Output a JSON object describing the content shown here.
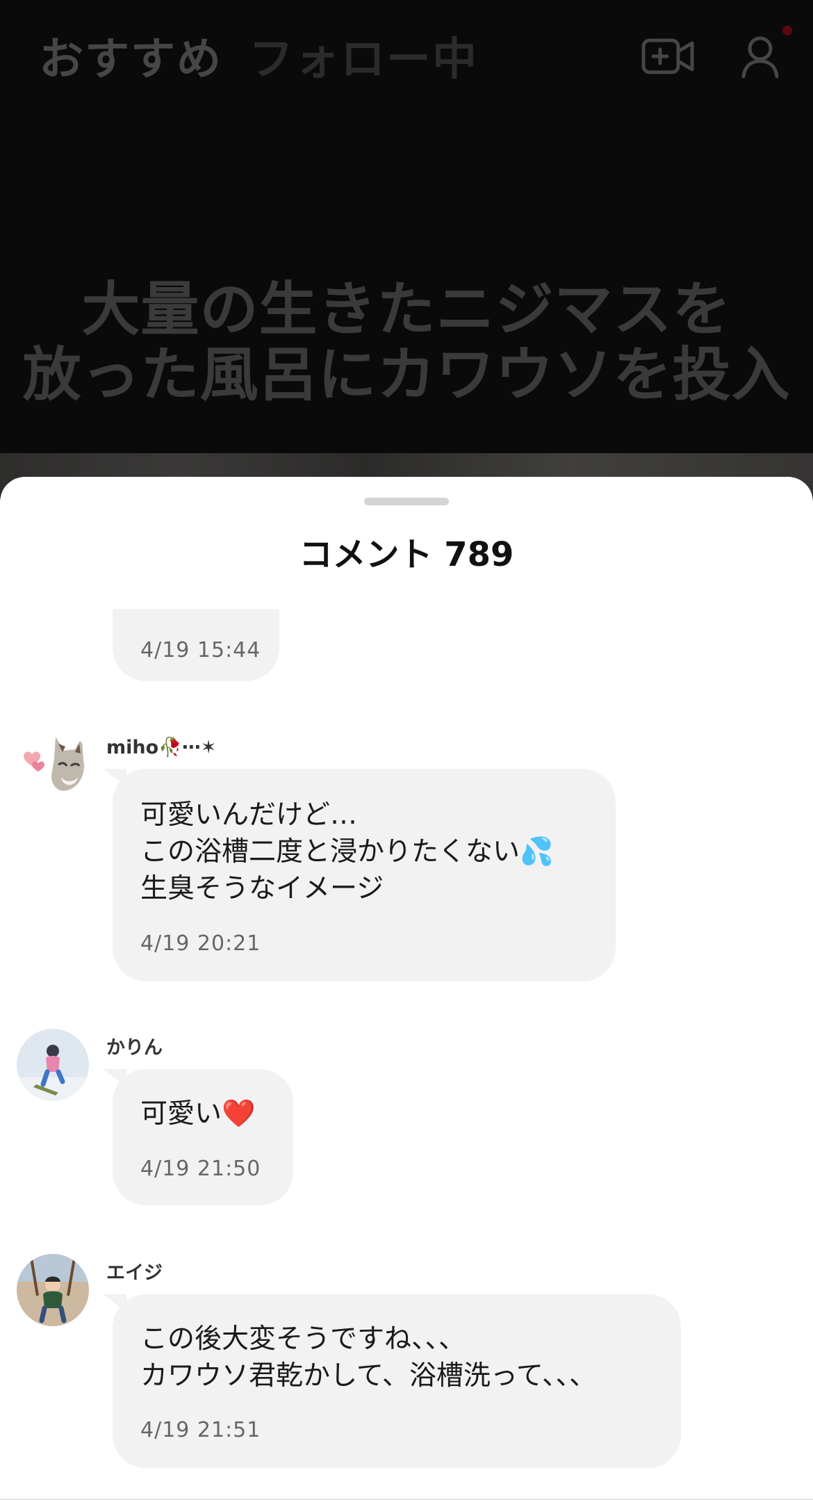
{
  "top_tabs": {
    "recommended": "おすすめ",
    "following": "フォロー中"
  },
  "top_icons": {
    "live": "live-camera-icon",
    "profile": "profile-icon",
    "notification_dot_color": "#5a0710"
  },
  "video": {
    "caption": "大量の生きたニジマスを\n放った風呂にカワウソを投入"
  },
  "comments_sheet": {
    "title": "コメント 789",
    "comments": [
      {
        "username": "",
        "text": "",
        "time": "4/19 15:44"
      },
      {
        "username": "miho🥀⋯✶",
        "text": "可愛いんだけど…\nこの浴槽二度と浸かりたくない💦\n生臭そうなイメージ",
        "time": "4/19 20:21"
      },
      {
        "username": "かりん",
        "text": "可愛い❤️",
        "time": "4/19 21:50"
      },
      {
        "username": "エイジ",
        "text": "この後大変そうですね、、、\nカワウソ君乾かして、浴槽洗って、、、",
        "time": "4/19 21:51"
      }
    ]
  }
}
